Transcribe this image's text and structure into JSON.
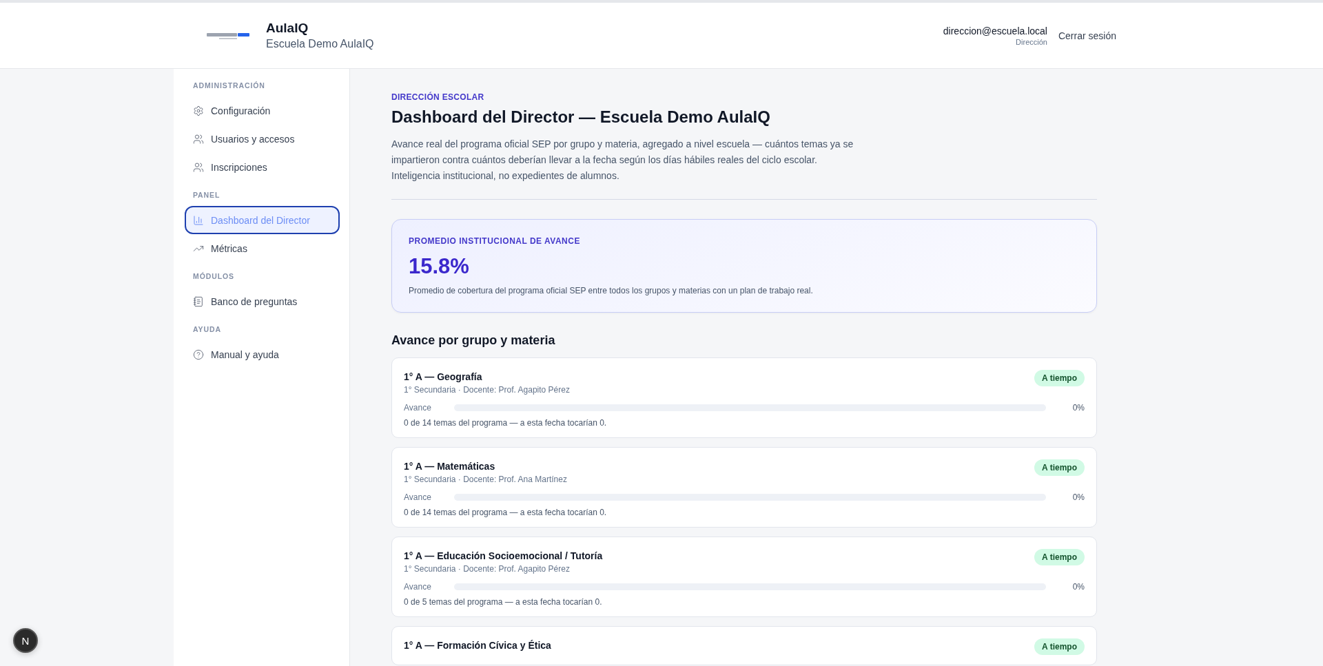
{
  "header": {
    "app_name": "AulaIQ",
    "school": "Escuela Demo AulaIQ",
    "user_email": "direccion@escuela.local",
    "user_role": "Dirección",
    "logout": "Cerrar sesión"
  },
  "sidebar": {
    "sections": [
      {
        "title": "ADMINISTRACIÓN",
        "items": [
          {
            "label": "Configuración",
            "selected": false
          },
          {
            "label": "Usuarios y accesos",
            "selected": false
          },
          {
            "label": "Inscripciones",
            "selected": false
          }
        ]
      },
      {
        "title": "PANEL",
        "items": [
          {
            "label": "Dashboard del Director",
            "selected": true
          },
          {
            "label": "Métricas",
            "selected": false
          }
        ]
      },
      {
        "title": "MÓDULOS",
        "items": [
          {
            "label": "Banco de preguntas",
            "selected": false
          }
        ]
      },
      {
        "title": "AYUDA",
        "items": [
          {
            "label": "Manual y ayuda",
            "selected": false
          }
        ]
      }
    ]
  },
  "page": {
    "eyebrow": "DIRECCIÓN ESCOLAR",
    "title": "Dashboard del Director — Escuela Demo AulaIQ",
    "description": "Avance real del programa oficial SEP por grupo y materia, agregado a nivel escuela — cuántos temas ya se impartieron contra cuántos deberían llevar a la fecha según los días hábiles reales del ciclo escolar. Inteligencia institucional, no expedientes de alumnos."
  },
  "summary": {
    "label": "PROMEDIO INSTITUCIONAL DE AVANCE",
    "value": "15.8%",
    "description": "Promedio de cobertura del programa oficial SEP entre todos los grupos y materias con un plan de trabajo real."
  },
  "progress_section": {
    "title": "Avance por grupo y materia",
    "cards": [
      {
        "title": "1° A — Geografía",
        "subtitle": "1° Secundaria · Docente: Prof. Agapito Pérez",
        "status": {
          "kind": "on_time",
          "label": "A tiempo"
        },
        "progress_label": "Avance",
        "level": 0,
        "percent": "0%",
        "note": "0 de 14 temas del programa — a esta fecha tocarían 0."
      },
      {
        "title": "1° A — Matemáticas",
        "subtitle": "1° Secundaria · Docente: Prof. Ana Martínez",
        "status": {
          "kind": "on_time",
          "label": "A tiempo"
        },
        "progress_label": "Avance",
        "level": 0,
        "percent": "0%",
        "note": "0 de 14 temas del programa — a esta fecha tocarían 0."
      },
      {
        "title": "1° A — Educación Socioemocional / Tutoría",
        "subtitle": "1° Secundaria · Docente: Prof. Agapito Pérez",
        "status": {
          "kind": "on_time",
          "label": "A tiempo"
        },
        "progress_label": "Avance",
        "level": 0,
        "percent": "0%",
        "note": "0 de 5 temas del programa — a esta fecha tocarían 0."
      },
      {
        "title": "1° A — Formación Cívica y Ética",
        "status": {
          "kind": "on_time",
          "label": "A tiempo"
        }
      }
    ]
  },
  "dev_badge": "N"
}
